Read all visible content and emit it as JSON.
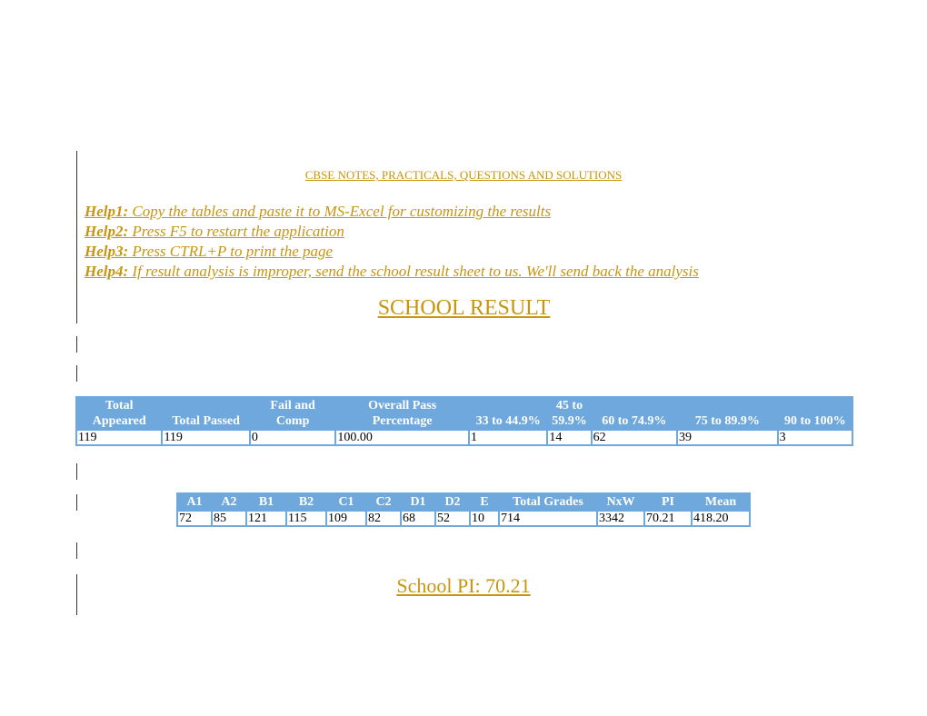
{
  "header": {
    "site_title": "CBSE NOTES, PRACTICALS, QUESTIONS AND SOLUTIONS"
  },
  "help": [
    {
      "label": "Help1:",
      "text": " Copy the tables and paste it to MS-Excel for customizing the results"
    },
    {
      "label": "Help2:",
      "text": " Press F5 to restart the application"
    },
    {
      "label": "Help3:",
      "text": " Press CTRL+P to print the page"
    },
    {
      "label": "Help4:",
      "text": " If result analysis is improper, send the school result sheet to us. We'll send back the analysis"
    }
  ],
  "section_title": "SCHOOL RESULT",
  "summary_table": {
    "headers": [
      "Total Appeared",
      "Total Passed",
      "Fail and Comp",
      "Overall Pass Percentage",
      "33 to 44.9%",
      "45 to 59.9%",
      "60 to 74.9%",
      "75 to 89.9%",
      "90 to 100%"
    ],
    "header_lines": [
      [
        "Total",
        "Appeared"
      ],
      [
        "",
        "Total Passed"
      ],
      [
        "Fail and",
        "Comp"
      ],
      [
        "Overall Pass",
        "Percentage"
      ],
      [
        "",
        "33 to 44.9%"
      ],
      [
        "45 to",
        "59.9%"
      ],
      [
        "",
        "60 to 74.9%"
      ],
      [
        "",
        "75 to 89.9%"
      ],
      [
        "",
        "90 to 100%"
      ]
    ],
    "row": [
      "119",
      "119",
      "0",
      "100.00",
      "1",
      "14",
      "62",
      "39",
      "3"
    ]
  },
  "grades_table": {
    "headers": [
      "A1",
      "A2",
      "B1",
      "B2",
      "C1",
      "C2",
      "D1",
      "D2",
      "E",
      "Total Grades",
      "NxW",
      "PI",
      "Mean"
    ],
    "row": [
      "72",
      "85",
      "121",
      "115",
      "109",
      "82",
      "68",
      "52",
      "10",
      "714",
      "3342",
      "70.21",
      "418.20"
    ]
  },
  "school_pi": "School PI: 70.21",
  "colors": {
    "accent_gold": "#c8960c",
    "table_header_blue": "#6fa8dc",
    "header_text": "#ffffff"
  }
}
